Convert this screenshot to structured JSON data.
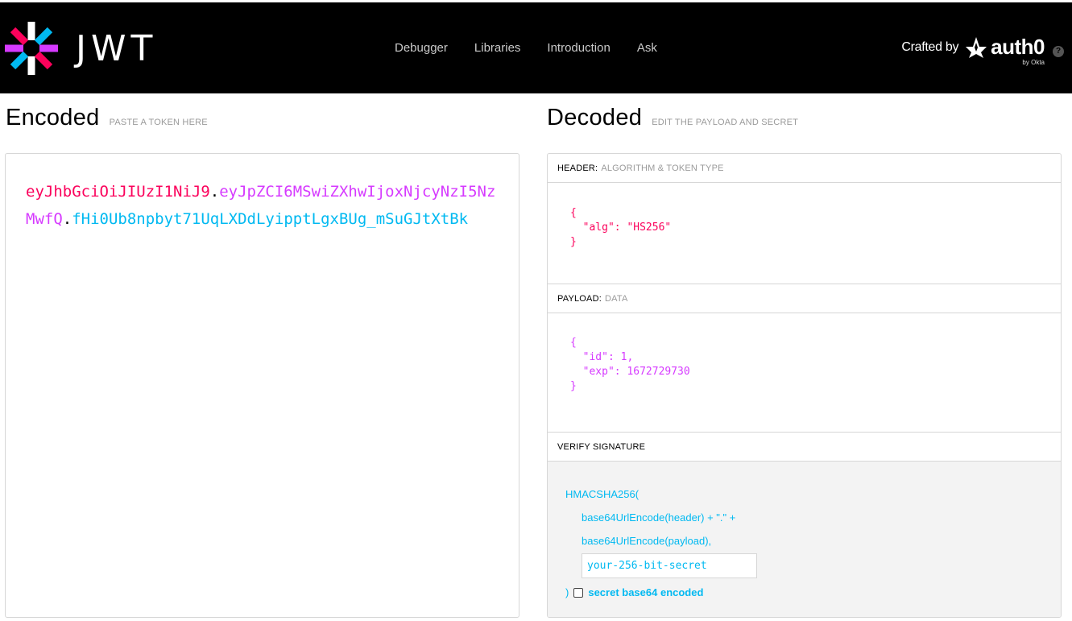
{
  "header": {
    "logo_text": "JWT",
    "nav": [
      "Debugger",
      "Libraries",
      "Introduction",
      "Ask"
    ],
    "crafted_by": "Crafted by",
    "brand": "auth0",
    "brand_sub": "by Okta",
    "help": "?"
  },
  "encoded": {
    "title": "Encoded",
    "subtitle": "PASTE A TOKEN HERE",
    "token_header": "eyJhbGciOiJIUzI1NiJ9",
    "token_payload": "eyJpZCI6MSwiZXhwIjoxNjcyNzI5NzMwfQ",
    "token_signature": "fHi0Ub8npbyt71UqLXDdLyipptLgxBUg_mSuGJtXtBk",
    "dot": "."
  },
  "decoded": {
    "title": "Decoded",
    "subtitle": "EDIT THE PAYLOAD AND SECRET",
    "header_label": "HEADER:",
    "header_sub": "ALGORITHM & TOKEN TYPE",
    "header_lines": [
      "{",
      "  \"alg\": \"HS256\"",
      "}"
    ],
    "payload_label": "PAYLOAD:",
    "payload_sub": "DATA",
    "payload_lines": [
      "{",
      "  \"id\": 1,",
      "  \"exp\": 1672729730",
      "}"
    ],
    "verify_label": "VERIFY SIGNATURE",
    "sig_fn": "HMACSHA256(",
    "sig_line1": "base64UrlEncode(header) + \".\" +",
    "sig_line2": "base64UrlEncode(payload),",
    "secret_value": "your-256-bit-secret",
    "sig_close": ")",
    "b64_label": "secret base64 encoded"
  },
  "colors": {
    "header": "#fb015b",
    "payload": "#d63aff",
    "signature": "#00b9f1"
  }
}
